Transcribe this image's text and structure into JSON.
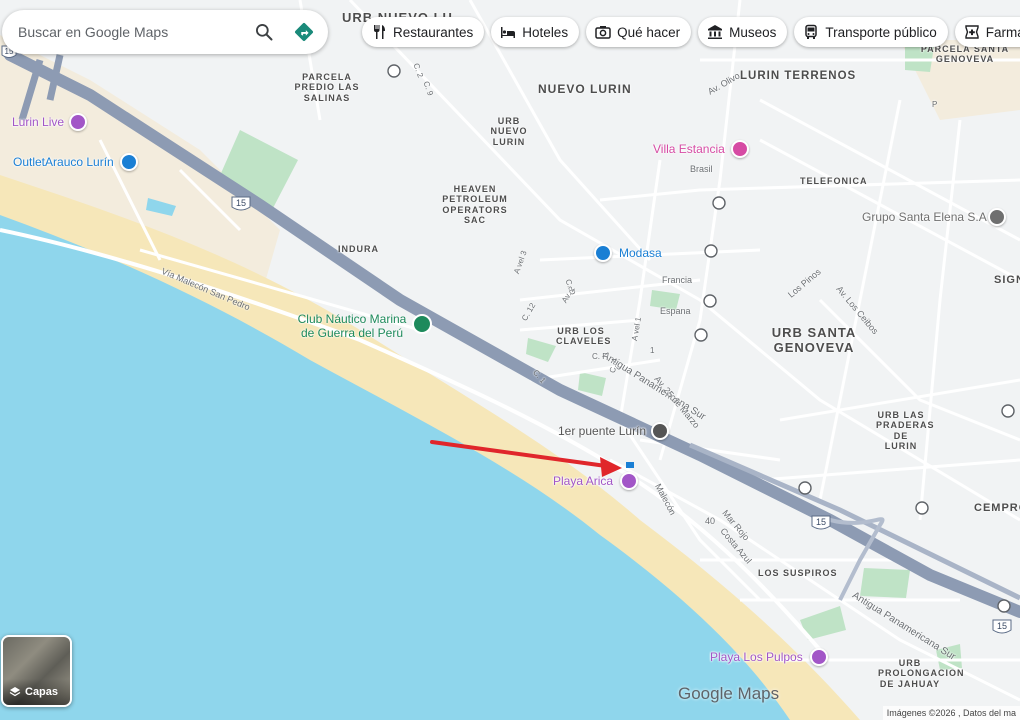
{
  "search": {
    "placeholder": "Buscar en Google Maps"
  },
  "chips": [
    {
      "label": "Restaurantes",
      "icon": "fork-knife-icon"
    },
    {
      "label": "Hoteles",
      "icon": "bed-icon"
    },
    {
      "label": "Qué hacer",
      "icon": "camera-icon"
    },
    {
      "label": "Museos",
      "icon": "museum-icon"
    },
    {
      "label": "Transporte público",
      "icon": "bus-icon"
    },
    {
      "label": "Farmacias",
      "icon": "pharmacy-icon"
    }
  ],
  "map": {
    "area_labels": {
      "urb_nuevo_lurin_top": "URB NUEVO LU",
      "nuevo_lurin": "NUEVO LURIN",
      "lurin_terrenos": "LURIN TERRENOS",
      "parcela_santa_genoveva": "PARCELA SANTA GENOVEVA",
      "parcela_las_salinas": "PARCELA PREDIO LAS SALINAS",
      "urb_nuevo_lurin": "URB NUEVO LURIN",
      "heaven": "HEAVEN PETROLEUM OPERATORS SAC",
      "telefonica": "TELEFONICA",
      "indura": "INDURA",
      "urb_santa_genoveva": "URB SANTA GENOVEVA",
      "urb_los_claveles": "URB LOS CLAVELES",
      "urb_las_praderas": "URB LAS PRADERAS DE LURIN",
      "los_suspiros": "LOS SUSPIROS",
      "urb_prolongacion": "URB PROLONGACION DE JAHUAY",
      "signo": "SIGN",
      "cempro": "CEMPRO"
    },
    "street_labels": {
      "malecon_san_pedro": "Vía Malecón San Pedro",
      "antigua_pan_sur_1": "Antigua Panamericana Sur",
      "antigua_pan_sur_2": "Antigua Panamericana Sur",
      "av_25_marzo": "Av. 25 de Marzo",
      "av_olivo": "Av. Olivo",
      "brasil": "Brasil",
      "francia": "Francia",
      "espana": "Espana",
      "los_pinos": "Los Pinos",
      "av_los_ceibos": "Av. Los Ceibos",
      "malecon": "Malecón",
      "mar_rojo": "Mar Rojo",
      "costa_azul": "Costa Azul",
      "c2": "C. 2",
      "c9": "C. 9",
      "avel3": "A vel 3",
      "cd": "C. D",
      "av2": "Av. 2",
      "c12": "C. 12",
      "c1": "C. 1",
      "cf": "C. F",
      "c4": "C. 4",
      "avel1": "A vel 1",
      "num1": "1",
      "num40": "40",
      "p": "P"
    },
    "places": {
      "lurin_live": "Lurin Live",
      "outlet": "OutletArauco Lurín",
      "villa_estancia": "Villa Estancia",
      "grupo_santa_elena": "Grupo Santa Elena S.A",
      "modasa": "Modasa",
      "club_nautico": "Club Náutico Marina de Guerra del Perú",
      "puente_lurin": "1er puente Lurín",
      "playa_arica": "Playa Arica",
      "playa_los_pulpos": "Playa Los Pulpos"
    },
    "highway_shield": "15",
    "colors": {
      "sea": "#8fd6ec",
      "beach": "#f6e7b9",
      "land": "#f1f3f4",
      "highway": "#8d9bb3",
      "road": "#ffffff",
      "park": "#bfe3c6",
      "arrow": "#e0262b",
      "place_purple": "#a256c7",
      "place_blue": "#1a7fd4",
      "place_pink": "#d64ba4",
      "place_green": "#1e8a5c"
    }
  },
  "layers": {
    "label": "Capas"
  },
  "brand": "Google Maps",
  "attribution": "Imágenes ©2026 , Datos del ma"
}
